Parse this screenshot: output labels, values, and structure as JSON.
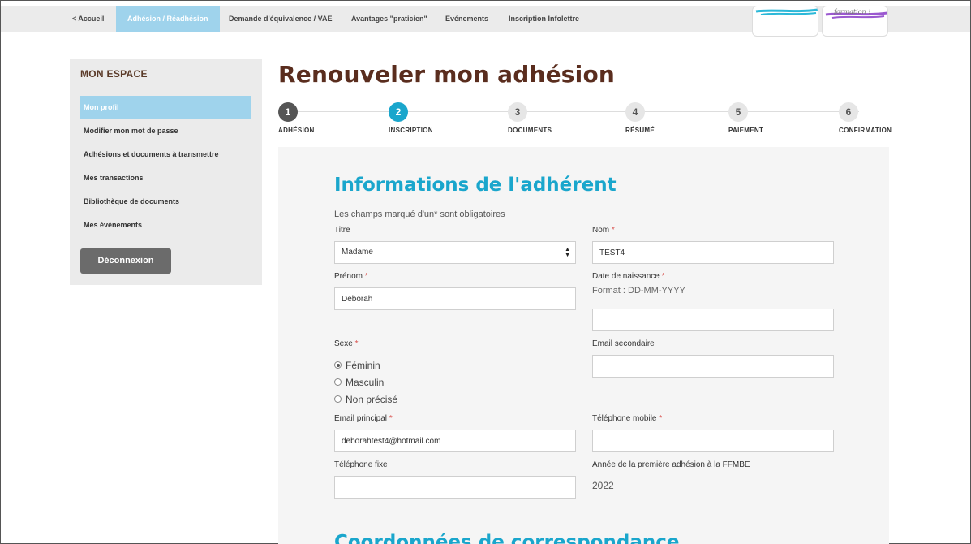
{
  "nav": {
    "items": [
      {
        "label": "<  Accueil"
      },
      {
        "label": "Adhésion / Réadhésion"
      },
      {
        "label": "Demande d'équivalence / VAE"
      },
      {
        "label": "Avantages \"praticien\""
      },
      {
        "label": "Evénements"
      },
      {
        "label": "Inscription Infolettre"
      }
    ],
    "logo_text": "formation !",
    "colors": {
      "nav_bg": "#ebebeb",
      "active": "#9fd3ec"
    }
  },
  "sidebar": {
    "title": "MON ESPACE",
    "items": [
      {
        "label": "Mon profil"
      },
      {
        "label": "Modifier mon mot de passe"
      },
      {
        "label": "Adhésions et documents à transmettre"
      },
      {
        "label": "Mes transactions"
      },
      {
        "label": "Bibliothèque de documents"
      },
      {
        "label": "Mes événements"
      }
    ],
    "logout_label": "Déconnexion"
  },
  "page": {
    "title": "Renouveler mon adhésion"
  },
  "stepper": {
    "current": 2,
    "steps": [
      {
        "number": "1",
        "label": "ADHÉSION"
      },
      {
        "number": "2",
        "label": "INSCRIPTION"
      },
      {
        "number": "3",
        "label": "DOCUMENTS"
      },
      {
        "number": "4",
        "label": "RÉSUMÉ"
      },
      {
        "number": "5",
        "label": "PAIEMENT"
      },
      {
        "number": "6",
        "label": "CONFIRMATION"
      }
    ],
    "colors": {
      "done": "#555555",
      "current": "#1aa6cc",
      "pending": "#e6e6e6"
    }
  },
  "form": {
    "section_title": "Informations de l'adhérent",
    "next_section_title": "Coordonnées de correspondance",
    "required_note": "Les champs marqué d'un* sont obligatoires",
    "required_mark": "*",
    "titre": {
      "label": "Titre",
      "value": "Madame"
    },
    "nom": {
      "label": "Nom",
      "value": "TEST4"
    },
    "prenom": {
      "label": "Prénom",
      "value": "Deborah"
    },
    "date_naissance": {
      "label": "Date de naissance",
      "hint": "Format : DD-MM-YYYY",
      "value": ""
    },
    "sexe": {
      "label": "Sexe",
      "options": [
        {
          "label": "Féminin",
          "checked": true
        },
        {
          "label": "Masculin",
          "checked": false
        },
        {
          "label": "Non précisé",
          "checked": false
        }
      ]
    },
    "email_secondaire": {
      "label": "Email secondaire",
      "value": ""
    },
    "email_principal": {
      "label": "Email principal",
      "value": "deborahtest4@hotmail.com"
    },
    "telephone_mobile": {
      "label": "Téléphone mobile",
      "value": ""
    },
    "telephone_fixe": {
      "label": "Téléphone fixe",
      "value": ""
    },
    "annee_adhesion": {
      "label": "Année de la première adhésion à la FFMBE",
      "value": "2022"
    },
    "colors": {
      "title": "#1aa6cc",
      "required": "#d9534f",
      "page_title": "#5a2d1e"
    }
  }
}
